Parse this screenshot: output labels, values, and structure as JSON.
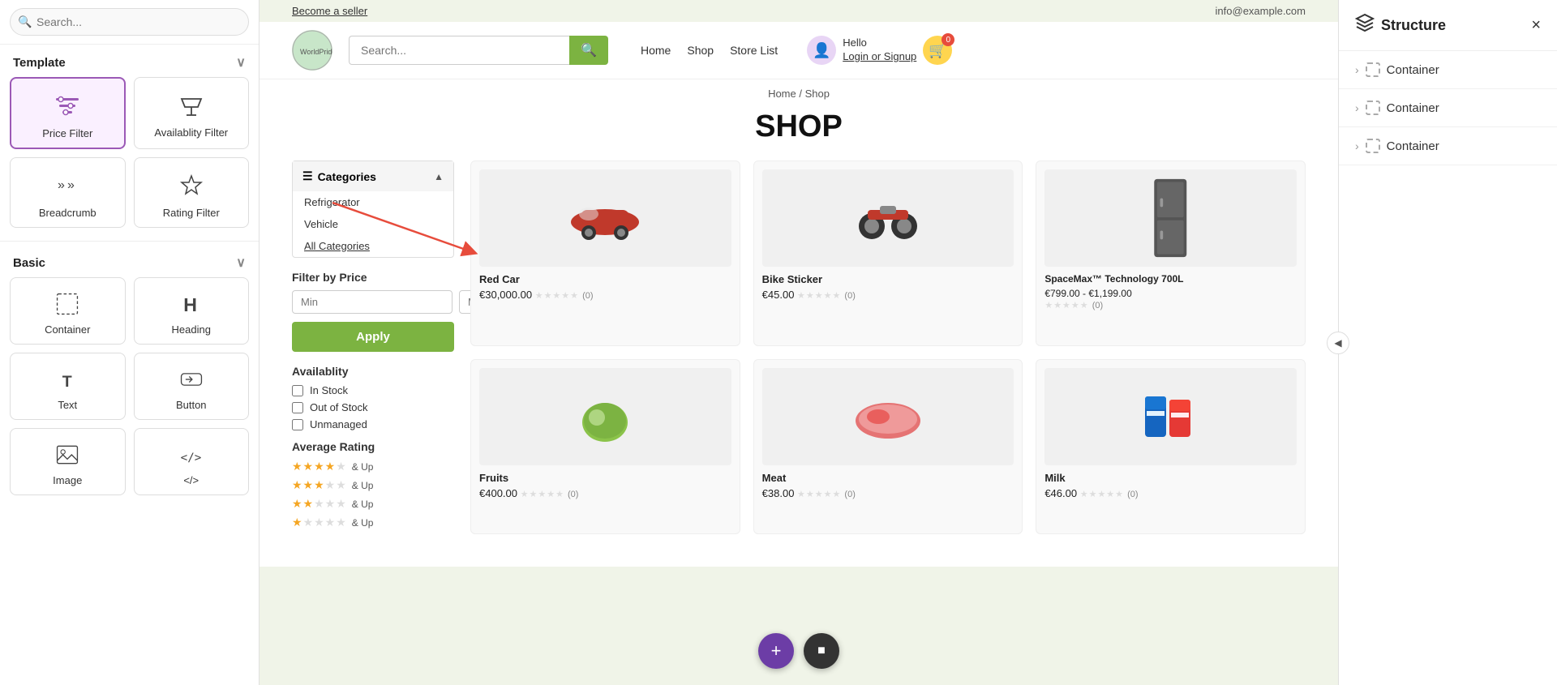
{
  "leftPanel": {
    "searchPlaceholder": "Search...",
    "templateSection": {
      "label": "Template",
      "items": [
        {
          "id": "price-filter",
          "label": "Price Filter",
          "active": true
        },
        {
          "id": "availability-filter",
          "label": "Availablity Filter",
          "active": false
        },
        {
          "id": "breadcrumb",
          "label": "Breadcrumb",
          "active": false
        },
        {
          "id": "rating-filter",
          "label": "Rating Filter",
          "active": false
        }
      ]
    },
    "basicSection": {
      "label": "Basic",
      "items": [
        {
          "id": "container",
          "label": "Container"
        },
        {
          "id": "heading",
          "label": "Heading"
        },
        {
          "id": "text",
          "label": "Text"
        },
        {
          "id": "button",
          "label": "Button"
        },
        {
          "id": "image",
          "label": "Image"
        },
        {
          "id": "code",
          "label": "</>"
        }
      ]
    }
  },
  "shop": {
    "topBar": {
      "sellerLink": "Become a seller",
      "email": "info@example.com"
    },
    "searchPlaceholder": "Search...",
    "nav": [
      "Home",
      "Shop",
      "Store List"
    ],
    "userGreeting": "Hello",
    "userAction": "Login or Signup",
    "breadcrumb": "Home / Shop",
    "title": "SHOP",
    "filter": {
      "categoriesLabel": "Categories",
      "categories": [
        "Refrigerator",
        "Vehicle",
        "All Categories"
      ],
      "filterByPriceLabel": "Filter by Price",
      "minPlaceholder": "Min",
      "maxPlaceholder": "Max",
      "applyLabel": "Apply",
      "availabilityLabel": "Availablity",
      "availabilityOptions": [
        "In Stock",
        "Out of Stock",
        "Unmanaged"
      ],
      "avgRatingLabel": "Average Rating",
      "ratings": [
        {
          "filled": 4,
          "empty": 1,
          "label": "& Up"
        },
        {
          "filled": 3,
          "empty": 2,
          "label": "& Up"
        },
        {
          "filled": 2,
          "empty": 3,
          "label": "& Up"
        },
        {
          "filled": 1,
          "empty": 4,
          "label": "& Up"
        }
      ]
    },
    "products": [
      {
        "name": "Red Car",
        "price": "€30,000.00",
        "rating": "(0)",
        "color": "#c8c8c8"
      },
      {
        "name": "Bike Sticker",
        "price": "€45.00",
        "rating": "(0)",
        "color": "#c8c8c8"
      },
      {
        "name": "SpaceMax™ Technology 700L",
        "priceRange": "€799.00 - €1,199.00",
        "rating": "(0)",
        "color": "#555"
      },
      {
        "name": "Fruits",
        "price": "€400.00",
        "rating": "(0)",
        "color": "#8bc34a"
      },
      {
        "name": "Meat",
        "price": "€38.00",
        "rating": "(0)",
        "color": "#c8c8c8"
      },
      {
        "name": "Milk",
        "price": "€46.00",
        "rating": "(0)",
        "color": "#c8c8c8"
      }
    ]
  },
  "rightPanel": {
    "title": "Structure",
    "closeLabel": "×",
    "containers": [
      {
        "label": "Container"
      },
      {
        "label": "Container"
      },
      {
        "label": "Container"
      }
    ]
  }
}
